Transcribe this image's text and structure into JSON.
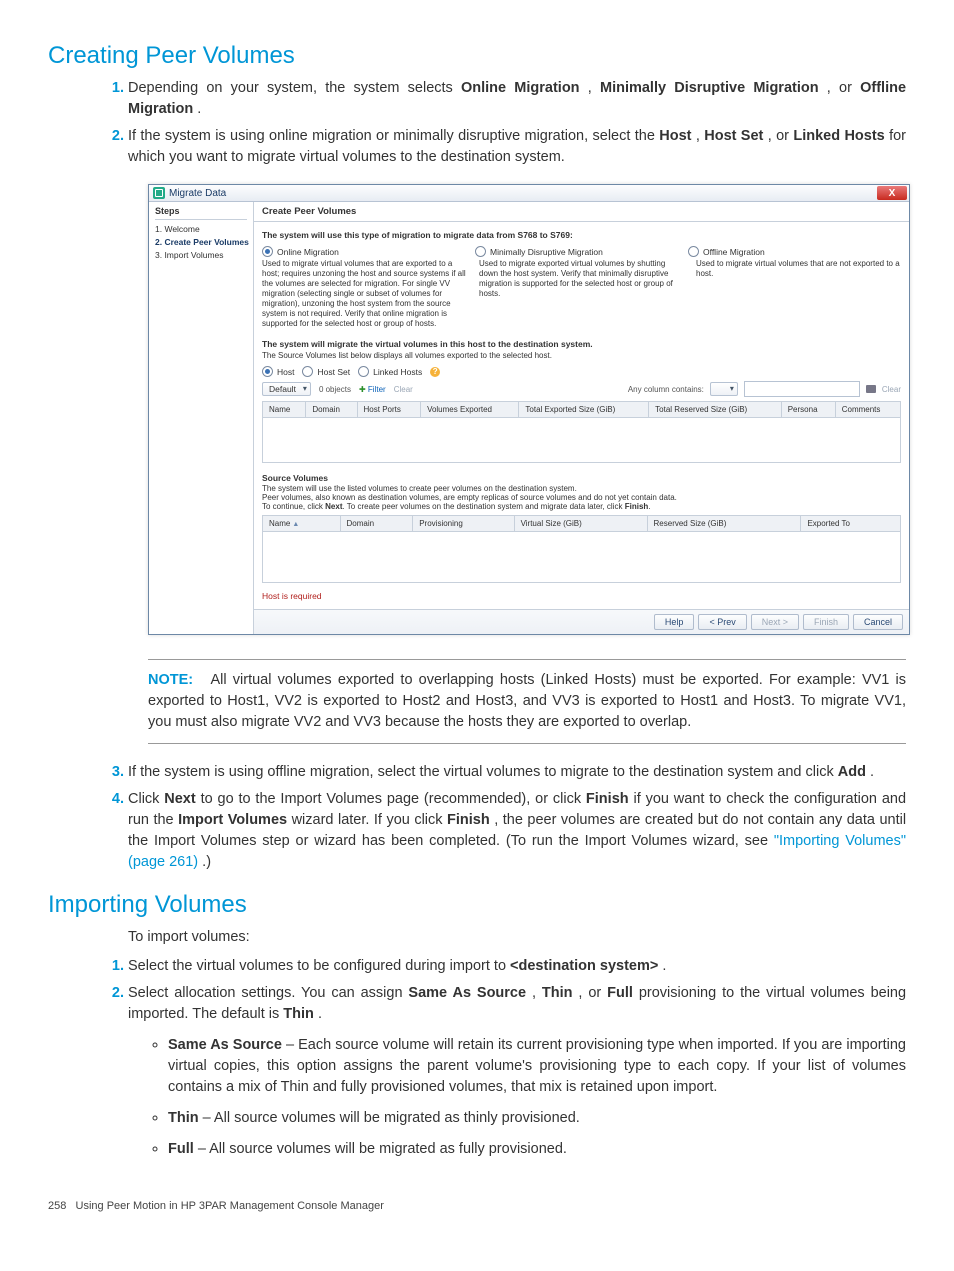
{
  "section1": {
    "title": "Creating Peer Volumes",
    "li1_a": "Depending on your system, the system selects ",
    "li1_b1": "Online Migration",
    "li1_sep1": ", ",
    "li1_b2": "Minimally Disruptive Migration",
    "li1_sep2": ", or ",
    "li1_b3": "Offline Migration",
    "li1_end": ".",
    "li2_a": "If the system is using online migration or minimally disruptive migration, select the ",
    "li2_b1": "Host",
    "li2_sep1": ", ",
    "li2_b2": "Host Set",
    "li2_sep2": ", or ",
    "li2_b3": "Linked Hosts",
    "li2_end": " for which you want to migrate virtual volumes to the destination system."
  },
  "dialog": {
    "title": "Migrate Data",
    "close": "X",
    "steps_header": "Steps",
    "steps": {
      "s1": "1. Welcome",
      "s2": "2. Create Peer Volumes",
      "s3": "3. Import Volumes"
    },
    "panel_title": "Create Peer Volumes",
    "type_line": "The system will use this type of migration to migrate data from S768 to S769:",
    "radios": {
      "r1": "Online Migration",
      "r2": "Minimally Disruptive Migration",
      "r3": "Offline Migration"
    },
    "desc": {
      "d1": "Used to migrate virtual volumes that are exported to a host; requires unzoning the host and source systems if all the volumes are selected for migration. For single VV migration (selecting single or subset of volumes for migration), unzoning the host system from the source system is not required. Verify that online migration is supported for the selected host or group of hosts.",
      "d2": "Used to migrate exported virtual volumes by shutting down the host system. Verify that minimally disruptive migration is supported for the selected host or group of hosts.",
      "d3": "Used to migrate virtual volumes that are not exported to a host."
    },
    "host_line1": "The system will migrate the virtual volumes in this host to the destination system.",
    "host_line2": "The Source Volumes list below displays all volumes exported to the selected host.",
    "host_radios": {
      "h1": "Host",
      "h2": "Host Set",
      "h3": "Linked Hosts"
    },
    "filter": {
      "default": "Default",
      "count": "0 objects",
      "filter": "Filter",
      "clear": "Clear",
      "any_col": "Any column contains:",
      "clear2": "Clear"
    },
    "table1": {
      "c1": "Name",
      "c2": "Domain",
      "c3": "Host Ports",
      "c4": "Volumes Exported",
      "c5": "Total Exported Size (GiB)",
      "c6": "Total Reserved Size (GiB)",
      "c7": "Persona",
      "c8": "Comments"
    },
    "source": {
      "hdr": "Source Volumes",
      "l1": "The system will use the listed volumes to create peer volumes on the destination system.",
      "l2": "Peer volumes, also known as destination volumes, are empty replicas of source volumes and do not yet contain data.",
      "l3a": "To continue, click ",
      "l3b": "Next",
      "l3c": ". To create peer volumes on the destination system and migrate data later, click ",
      "l3d": "Finish",
      "l3e": "."
    },
    "table2": {
      "c1": "Name",
      "c2": "Domain",
      "c3": "Provisioning",
      "c4": "Virtual Size (GiB)",
      "c5": "Reserved Size (GiB)",
      "c6": "Exported To"
    },
    "error": "Host is required",
    "buttons": {
      "help": "Help",
      "prev": "< Prev",
      "next": "Next >",
      "finish": "Finish",
      "cancel": "Cancel"
    }
  },
  "note": {
    "kw": "NOTE:",
    "body": "All virtual volumes exported to overlapping hosts (Linked Hosts) must be exported. For example: VV1 is exported to Host1, VV2 is exported to Host2 and Host3, and VV3 is exported to Host1 and Host3. To migrate VV1, you must also migrate VV2 and VV3 because the hosts they are exported to overlap."
  },
  "cont": {
    "li3_a": "If the system is using offline migration, select the virtual volumes to migrate to the destination system and click ",
    "li3_b": "Add",
    "li3_end": ".",
    "li4_a": "Click ",
    "li4_b1": "Next",
    "li4_c": " to go to the Import Volumes page (recommended), or click ",
    "li4_b2": "Finish",
    "li4_d": " if you want to check the configuration and run the ",
    "li4_b3": "Import Volumes",
    "li4_e": " wizard later. If you click ",
    "li4_b4": "Finish",
    "li4_f": ", the peer volumes are created but do not contain any data until the Import Volumes step or wizard has been completed. (To run the Import Volumes wizard, see ",
    "li4_link": "\"Importing Volumes\" (page 261)",
    "li4_g": ".)"
  },
  "section2": {
    "title": "Importing Volumes",
    "intro": "To import volumes:",
    "li1_a": "Select the virtual volumes to be configured during import to ",
    "li1_b": "<destination system>",
    "li1_end": ".",
    "li2_a": "Select allocation settings. You can assign ",
    "li2_b1": "Same As Source",
    "li2_s1": ", ",
    "li2_b2": "Thin",
    "li2_s2": ", or ",
    "li2_b3": "Full",
    "li2_c": " provisioning to the virtual volumes being imported. The default is ",
    "li2_b4": "Thin",
    "li2_end": ".",
    "b1_h": "Same As Source",
    "b1_t": " – Each source volume will retain its current provisioning type when imported. If you are importing virtual copies, this option assigns the parent volume's provisioning type to each copy. If your list of volumes contains a mix of Thin and fully provisioned volumes, that mix is retained upon import.",
    "b2_h": "Thin",
    "b2_t": " – All source volumes will be migrated as thinly provisioned.",
    "b3_h": "Full",
    "b3_t": " – All source volumes will be migrated as fully provisioned."
  },
  "footer": {
    "page": "258",
    "text": "Using Peer Motion in HP 3PAR Management Console Manager"
  }
}
